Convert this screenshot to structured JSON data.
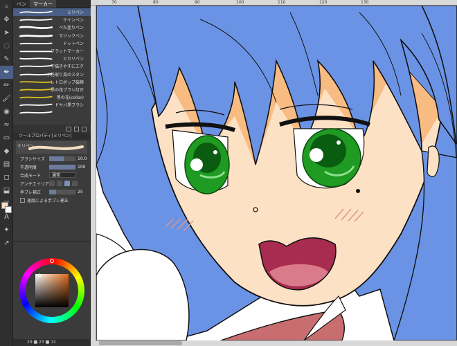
{
  "subtool_panel": {
    "tabs": [
      {
        "label": "ペン"
      },
      {
        "label": "マーカー"
      }
    ],
    "brushes": [
      {
        "name": "ミリペン",
        "selected": true
      },
      {
        "name": "サインペン",
        "selected": false
      },
      {
        "name": "べた塗りペン",
        "selected": false
      },
      {
        "name": "マジックペン",
        "selected": false
      },
      {
        "name": "ドットペン",
        "selected": false
      },
      {
        "name": "フラットマーカー",
        "selected": false
      },
      {
        "name": "ヒカリペン",
        "selected": false
      },
      {
        "name": "下描きやすにエク",
        "selected": false
      },
      {
        "name": "小花取り見のスタン",
        "selected": false
      },
      {
        "name": "レトロポップ装飾",
        "selected": false
      },
      {
        "name": "黒の花ブラシ訂正",
        "selected": false
      },
      {
        "name": "黒の花(collar)",
        "selected": false
      },
      {
        "name": "ドヤバ黒ブラシ",
        "selected": false
      },
      {
        "name": "",
        "selected": false
      }
    ]
  },
  "tool_property": {
    "title": "ツールプロパティ[ミリペン]",
    "preview_label": "ミリペン",
    "brush_size_label": "ブラシサイズ",
    "brush_size_value": "10.0",
    "brush_size_fraction": 0.55,
    "opacity_label": "不透明度",
    "opacity_value": "100",
    "opacity_fraction": 1.0,
    "blend_mode_label": "合成モード",
    "blend_mode_value": "通常",
    "antialias_label": "アンチエイリアス",
    "stabilization_label": "手ブレ補正",
    "stabilization_value": "25",
    "stabilization_fraction": 0.25,
    "speed_stabilization_label": "速度による手ブレ補正"
  },
  "color_panel": {
    "footer_text": "29 ■ 23 ■ 11",
    "hue_selected": "#e06a15",
    "main_color": "#f6ddc3",
    "sub_color": "#ffffff"
  },
  "canvas": {
    "ruler_labels": [
      "70",
      "80",
      "90",
      "100",
      "110",
      "120",
      "130"
    ]
  },
  "colors": {
    "hair": "#6b93e5",
    "skin": "#fde1c5",
    "skin_shadow": "#f8bb82",
    "eye_green": "#1f9a22",
    "mouth": "#a82c4f",
    "tongue": "#d97b8a",
    "clothing": "#c86e70"
  }
}
